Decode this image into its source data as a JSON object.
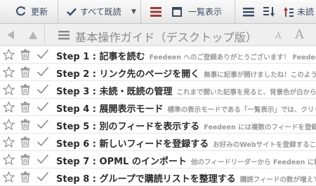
{
  "toolbar": {
    "refresh_label": "更新",
    "mark_all_read_label": "すべて既読",
    "list_view_label": "一覧表示",
    "unread_label": "未読"
  },
  "title_bar": {
    "title": "基本操作ガイド（デスクトップ版）",
    "font_small_label": "A",
    "font_large_label": "A"
  },
  "items": [
    {
      "title": "Step 1 : 記事を読む",
      "snippet": "Feedeen へのご登録ありがとうございます！ Feedeen"
    },
    {
      "title": "Step 2 : リンク先のページを開く",
      "snippet": "無事に記事が開けましたね！このように"
    },
    {
      "title": "Step 3 : 未読・既読の管理",
      "snippet": "これまで開いた記事を見ると、背景色が白から"
    },
    {
      "title": "Step 4 : 展開表示モード",
      "snippet": "標準の表示モードである「一覧表示」では、クリッ"
    },
    {
      "title": "Step 5 : 別のフィードを表示する",
      "snippet": "Feedeen には複数のフィードを登録で"
    },
    {
      "title": "Step 6 : 新しいフィードを登録する",
      "snippet": "お好みのWebサイトを登録するこ"
    },
    {
      "title": "Step 7 : OPML のインポート",
      "snippet": "他のフィードリーダーから Feedeen に移行"
    },
    {
      "title": "Step 8 : グループで購読リストを整理する",
      "snippet": "購読フィードの数が増えて"
    }
  ]
}
